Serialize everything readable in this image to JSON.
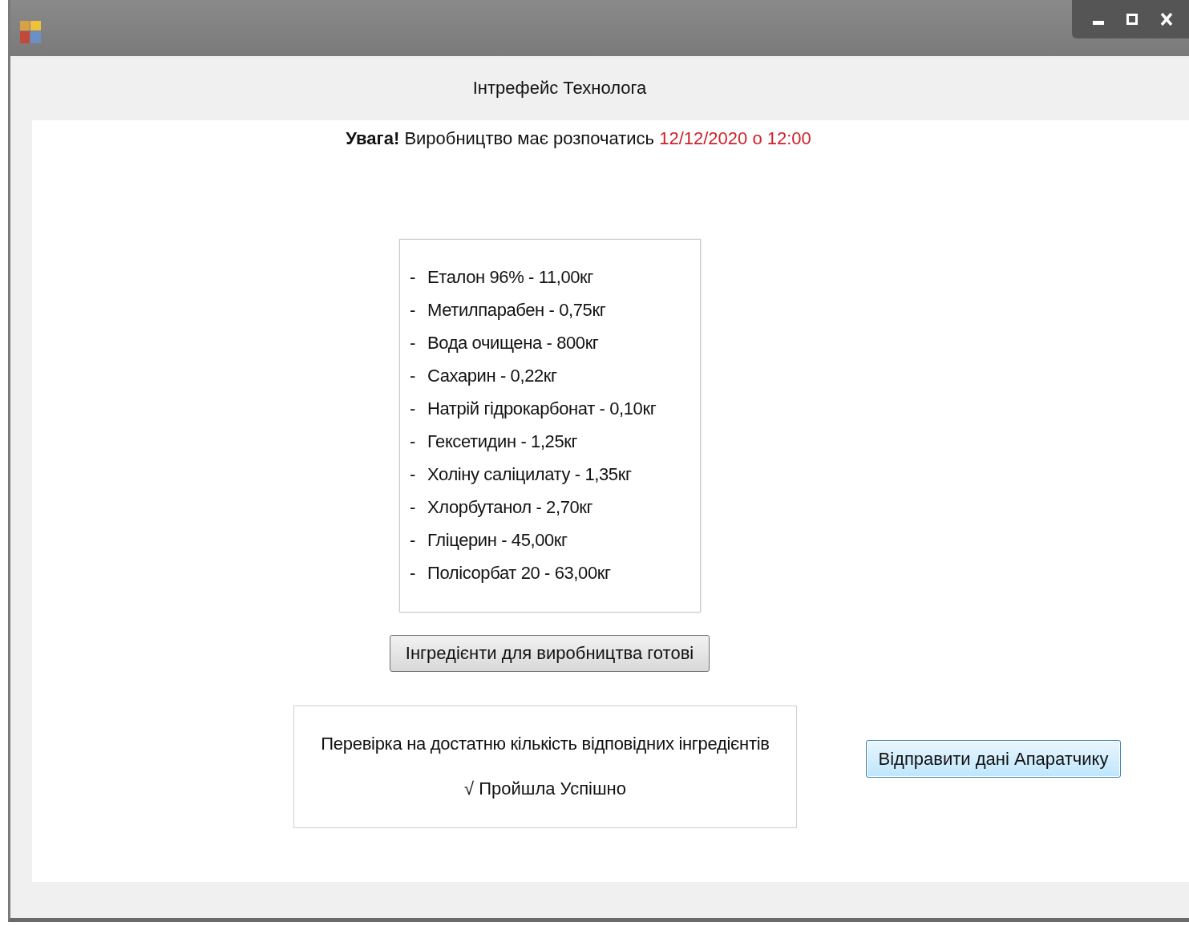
{
  "window": {
    "title": "Інтрефейс Технолога"
  },
  "warning": {
    "label": "Увага!",
    "text": "Виробництво має розпочатись",
    "date": "12/12/2020 о 12:00"
  },
  "ingredients": [
    {
      "bullet": "-",
      "text": "Еталон 96% - 11,00кг"
    },
    {
      "bullet": "-",
      "text": "Метилпарабен - 0,75кг"
    },
    {
      "bullet": "-",
      "text": "Вода очищена  - 800кг"
    },
    {
      "bullet": "-",
      "text": "Сахарин - 0,22кг"
    },
    {
      "bullet": "-",
      "text": "Натрій гідрокарбонат - 0,10кг"
    },
    {
      "bullet": "-",
      "text": "Гексетидин - 1,25кг"
    },
    {
      "bullet": "-",
      "text": "Холіну саліцилату - 1,35кг"
    },
    {
      "bullet": "-",
      "text": "Хлорбутанол - 2,70кг"
    },
    {
      "bullet": "-",
      "text": "Гліцерин - 45,00кг"
    },
    {
      "bullet": "-",
      "text": "Полісорбат 20 - 63,00кг"
    }
  ],
  "ready_button": "Інгредієнти для виробництва готові",
  "check": {
    "title": "Перевірка на достатню кількість відповідних інгредієнтів",
    "result": "√ Пройшла Успішно"
  },
  "send_button": "Відправити дані Апаратчику"
}
